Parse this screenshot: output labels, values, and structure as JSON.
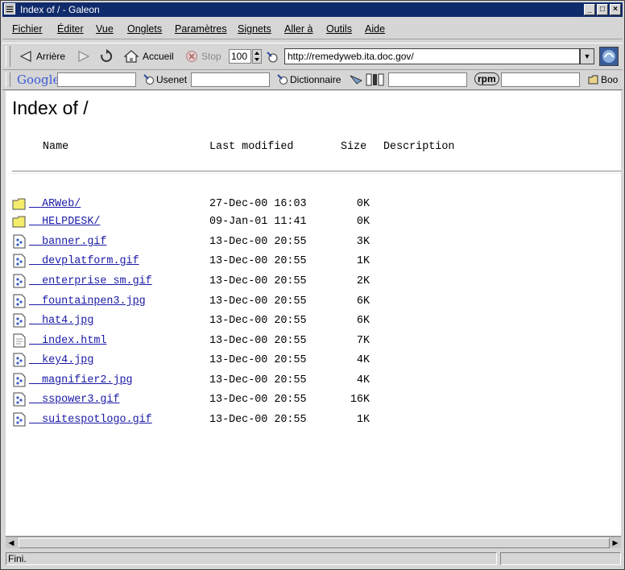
{
  "window": {
    "title": "Index of / - Galeon"
  },
  "menu": [
    "Fichier",
    "Éditer",
    "Vue",
    "Onglets",
    "Paramètres",
    "Signets",
    "Aller à",
    "Outils",
    "Aide"
  ],
  "toolbar": {
    "back_label": "Arrière",
    "home_label": "Accueil",
    "stop_label": "Stop",
    "zoom_value": "100",
    "url": "http://remedyweb.ita.doc.gov/"
  },
  "bookmarks_bar": {
    "google_label": "Google",
    "usenet_label": "Usenet",
    "dictionary_label": "Dictionnaire",
    "rpm_label": "rpm",
    "bookmarks_label": "Boo"
  },
  "page": {
    "heading": "Index of /",
    "columns": {
      "name": "Name",
      "modified": "Last modified",
      "size": "Size",
      "description": "Description"
    },
    "entries": [
      {
        "name": "ARWeb/",
        "modified": "27-Dec-00 16:03",
        "size": "0K",
        "kind": "folder"
      },
      {
        "name": "HELPDESK/",
        "modified": "09-Jan-01 11:41",
        "size": "0K",
        "kind": "folder"
      },
      {
        "name": "banner.gif",
        "modified": "13-Dec-00 20:55",
        "size": "3K",
        "kind": "image"
      },
      {
        "name": "devplatform.gif",
        "modified": "13-Dec-00 20:55",
        "size": "1K",
        "kind": "image"
      },
      {
        "name": "enterprise_sm.gif",
        "modified": "13-Dec-00 20:55",
        "size": "2K",
        "kind": "image"
      },
      {
        "name": "fountainpen3.jpg",
        "modified": "13-Dec-00 20:55",
        "size": "6K",
        "kind": "image"
      },
      {
        "name": "hat4.jpg",
        "modified": "13-Dec-00 20:55",
        "size": "6K",
        "kind": "image"
      },
      {
        "name": "index.html",
        "modified": "13-Dec-00 20:55",
        "size": "7K",
        "kind": "text"
      },
      {
        "name": "key4.jpg",
        "modified": "13-Dec-00 20:55",
        "size": "4K",
        "kind": "image"
      },
      {
        "name": "magnifier2.jpg",
        "modified": "13-Dec-00 20:55",
        "size": "4K",
        "kind": "image"
      },
      {
        "name": "sspower3.gif",
        "modified": "13-Dec-00 20:55",
        "size": "16K",
        "kind": "image"
      },
      {
        "name": "suitespotlogo.gif",
        "modified": "13-Dec-00 20:55",
        "size": "1K",
        "kind": "image"
      }
    ]
  },
  "status": {
    "text": "Fini."
  },
  "colors": {
    "titlebar": "#102b6b",
    "link": "#1a1aa6",
    "folder": "#f4ec6a"
  }
}
